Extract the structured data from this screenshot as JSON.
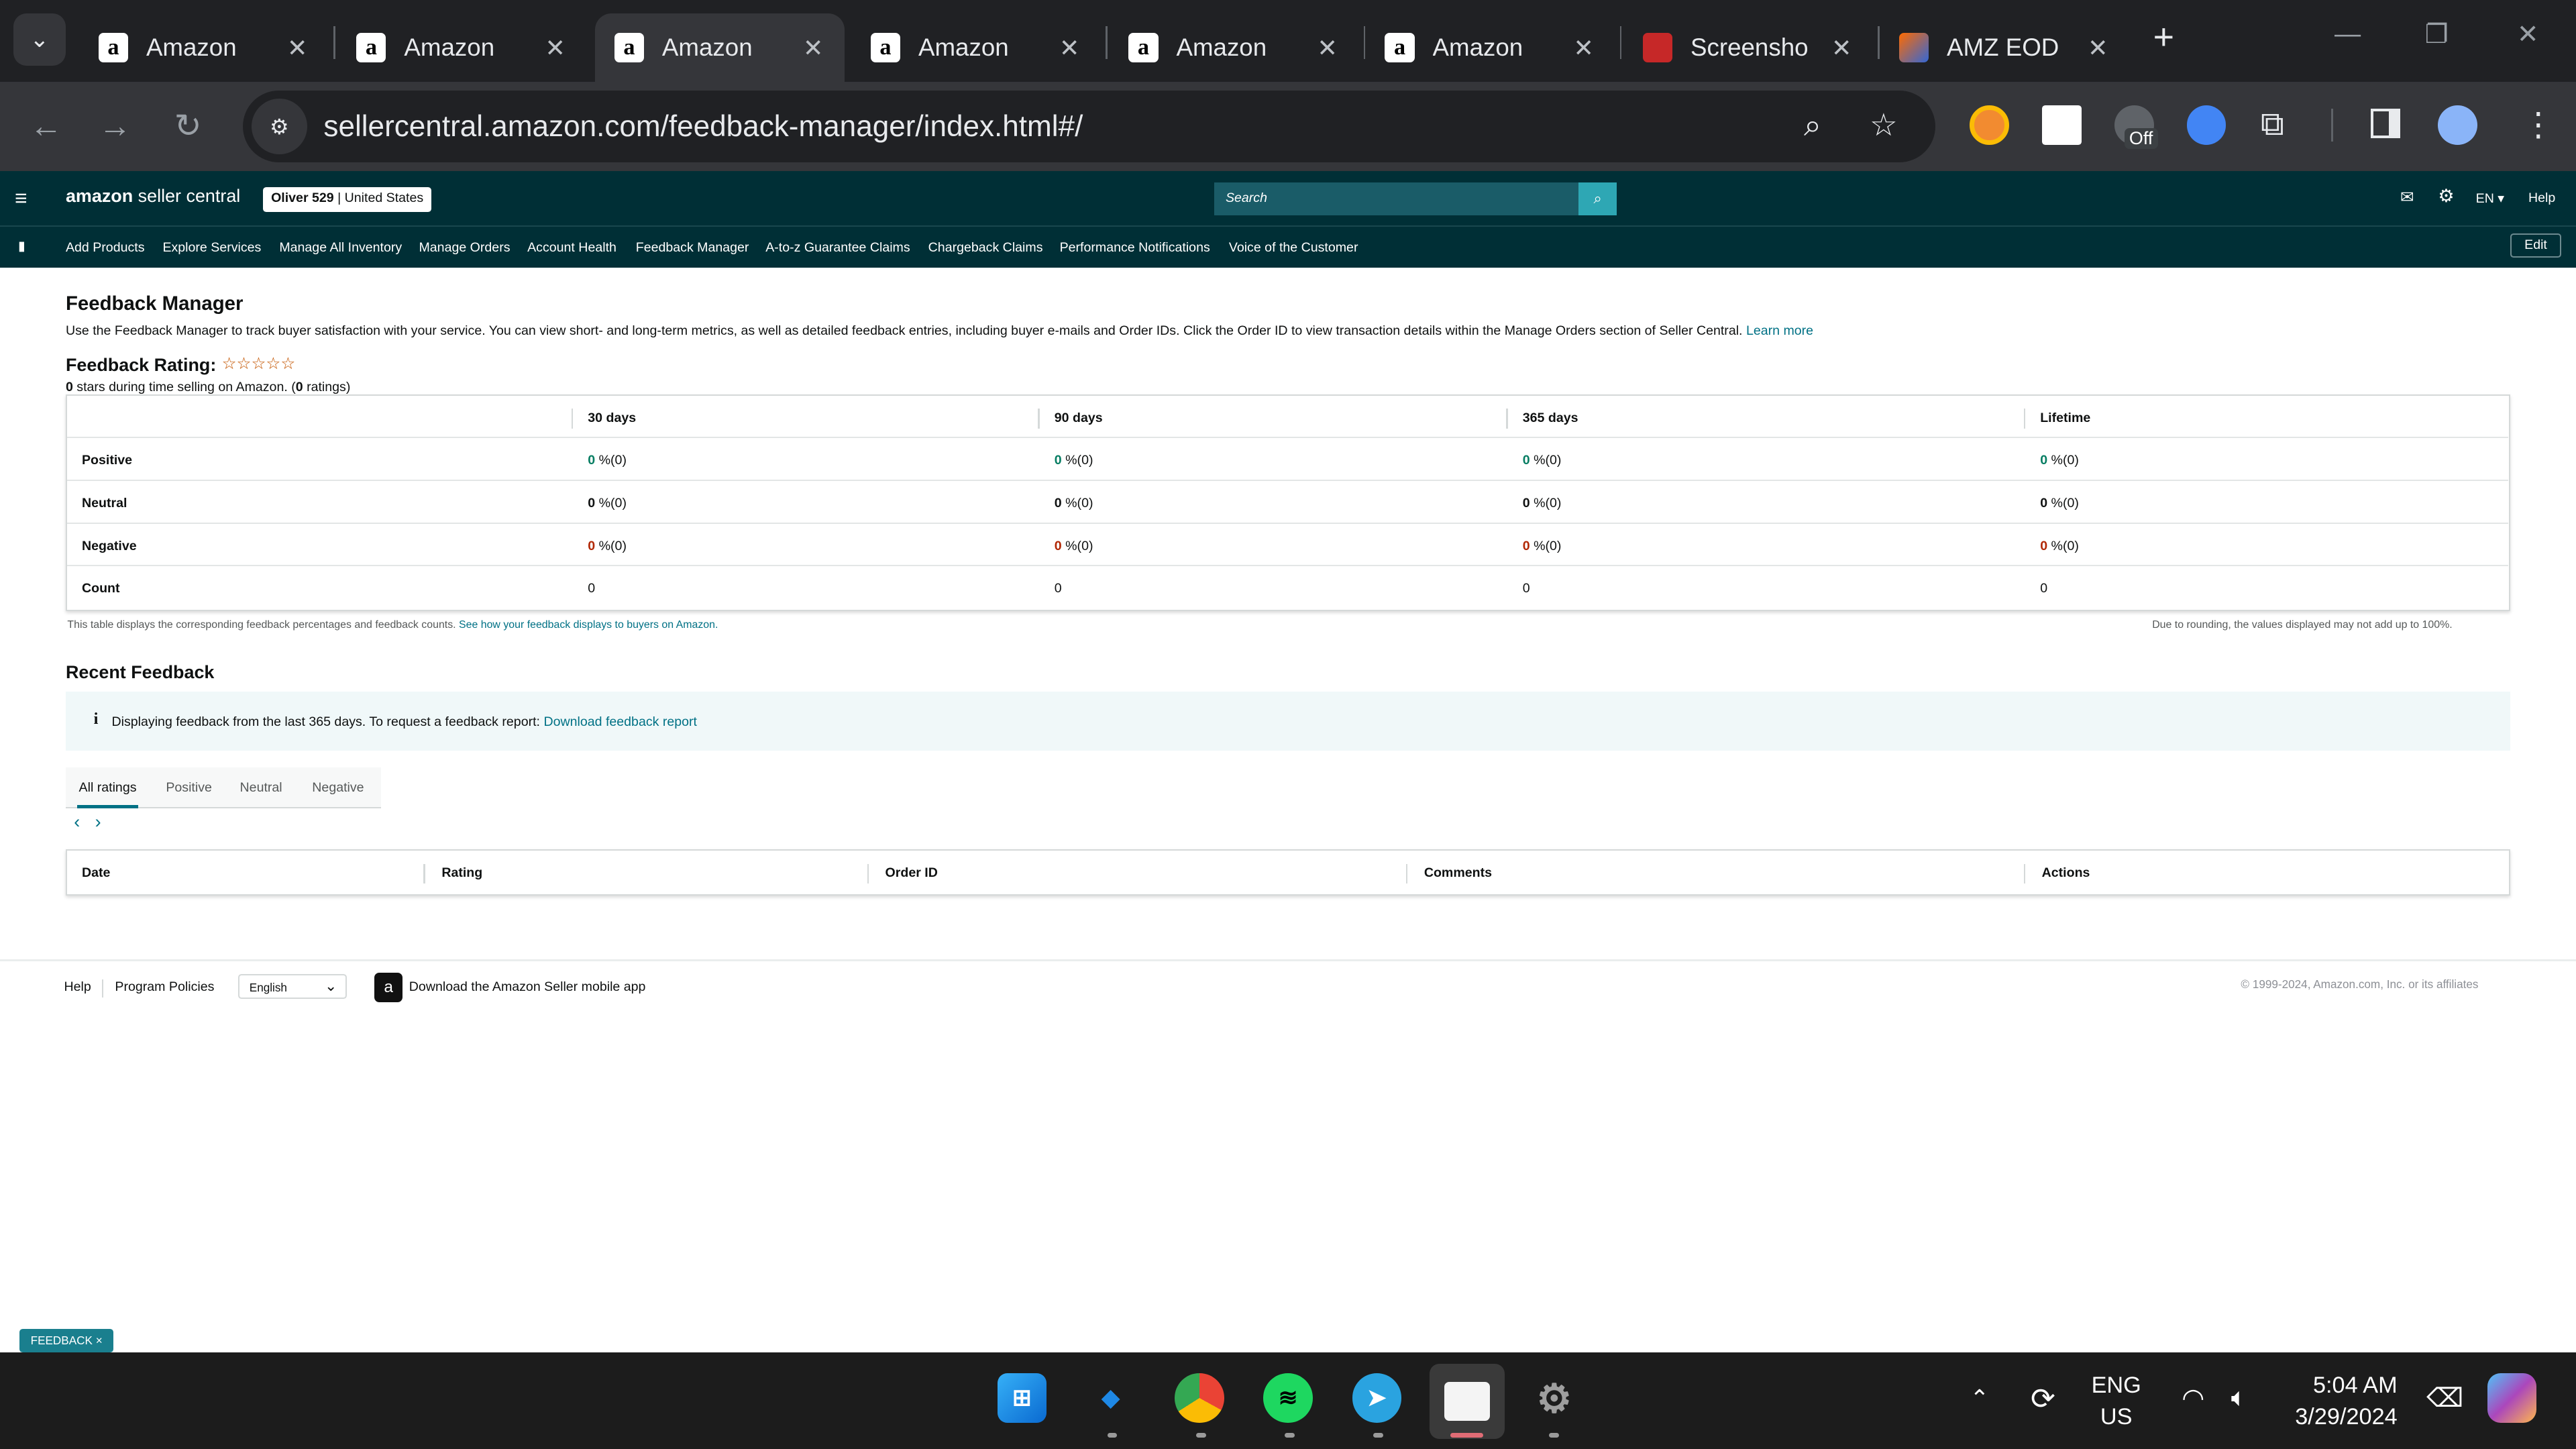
{
  "browser": {
    "tabs": [
      {
        "title": "Amazon",
        "icon": "amazon-a-icon"
      },
      {
        "title": "Amazon",
        "icon": "amazon-a-icon"
      },
      {
        "title": "Amazon",
        "icon": "amazon-a-icon",
        "active": true
      },
      {
        "title": "Amazon",
        "icon": "amazon-a-icon"
      },
      {
        "title": "Amazon",
        "icon": "amazon-a-icon"
      },
      {
        "title": "Amazon",
        "icon": "amazon-a-icon"
      },
      {
        "title": "Screensho",
        "icon": "screenshot-app-icon"
      },
      {
        "title": "AMZ EOD",
        "icon": "amz-eod-icon"
      }
    ],
    "url": "sellercentral.amazon.com/feedback-manager/index.html#/",
    "extension_badge": "Off"
  },
  "header": {
    "logo_main": "amazon",
    "logo_sub": "seller central",
    "account": "Oliver 529",
    "marketplace": "United States",
    "search_placeholder": "Search",
    "lang": "EN",
    "help": "Help"
  },
  "nav": {
    "items": [
      "Add Products",
      "Explore Services",
      "Manage All Inventory",
      "Manage Orders",
      "Account Health",
      "Feedback Manager",
      "A-to-z Guarantee Claims",
      "Chargeback Claims",
      "Performance Notifications",
      "Voice of the Customer"
    ],
    "edit": "Edit"
  },
  "page": {
    "title": "Feedback Manager",
    "description": "Use the Feedback Manager to track buyer satisfaction with your service. You can view short- and long-term metrics, as well as detailed feedback entries, including buyer e-mails and Order IDs. Click the Order ID to view transaction details within the Manage Orders section of Seller Central.",
    "learn_more": "Learn more",
    "rating_label": "Feedback Rating:",
    "stars_shown": "☆☆☆☆☆",
    "rating_value": "0",
    "rating_sub_mid": " stars during time selling on Amazon. (",
    "rating_count": "0",
    "rating_sub_end": " ratings)"
  },
  "feedback_table": {
    "columns": [
      "30 days",
      "90 days",
      "365 days",
      "Lifetime"
    ],
    "rows": [
      {
        "label": "Positive",
        "values": [
          "0",
          "0",
          "0",
          "0"
        ],
        "counts": [
          "%(0)",
          "%(0)",
          "%(0)",
          "%(0)"
        ]
      },
      {
        "label": "Neutral",
        "values": [
          "0",
          "0",
          "0",
          "0"
        ],
        "counts": [
          "%(0)",
          "%(0)",
          "%(0)",
          "%(0)"
        ]
      },
      {
        "label": "Negative",
        "values": [
          "0",
          "0",
          "0",
          "0"
        ],
        "counts": [
          "%(0)",
          "%(0)",
          "%(0)",
          "%(0)"
        ]
      },
      {
        "label": "Count",
        "values": [
          "0",
          "0",
          "0",
          "0"
        ]
      }
    ],
    "note_left": "This table displays the corresponding feedback percentages and feedback counts.",
    "note_link": "See how your feedback displays to buyers on Amazon.",
    "note_right": "Due to rounding, the values displayed may not add up to 100%."
  },
  "recent": {
    "title": "Recent Feedback",
    "info_text": "Displaying feedback from the last 365 days. To request a feedback report:",
    "info_link": "Download feedback report",
    "tabs": [
      "All ratings",
      "Positive",
      "Neutral",
      "Negative"
    ],
    "columns": [
      "Date",
      "Rating",
      "Order ID",
      "Comments",
      "Actions"
    ]
  },
  "footer": {
    "help": "Help",
    "policies": "Program Policies",
    "language": "English",
    "app": "Download the Amazon Seller mobile app",
    "copyright": "© 1999-2024, Amazon.com, Inc. or its affiliates",
    "feedback_badge": "FEEDBACK ×"
  },
  "taskbar": {
    "lang_top": "ENG",
    "lang_bottom": "US",
    "time": "5:04 AM",
    "date": "3/29/2024"
  }
}
